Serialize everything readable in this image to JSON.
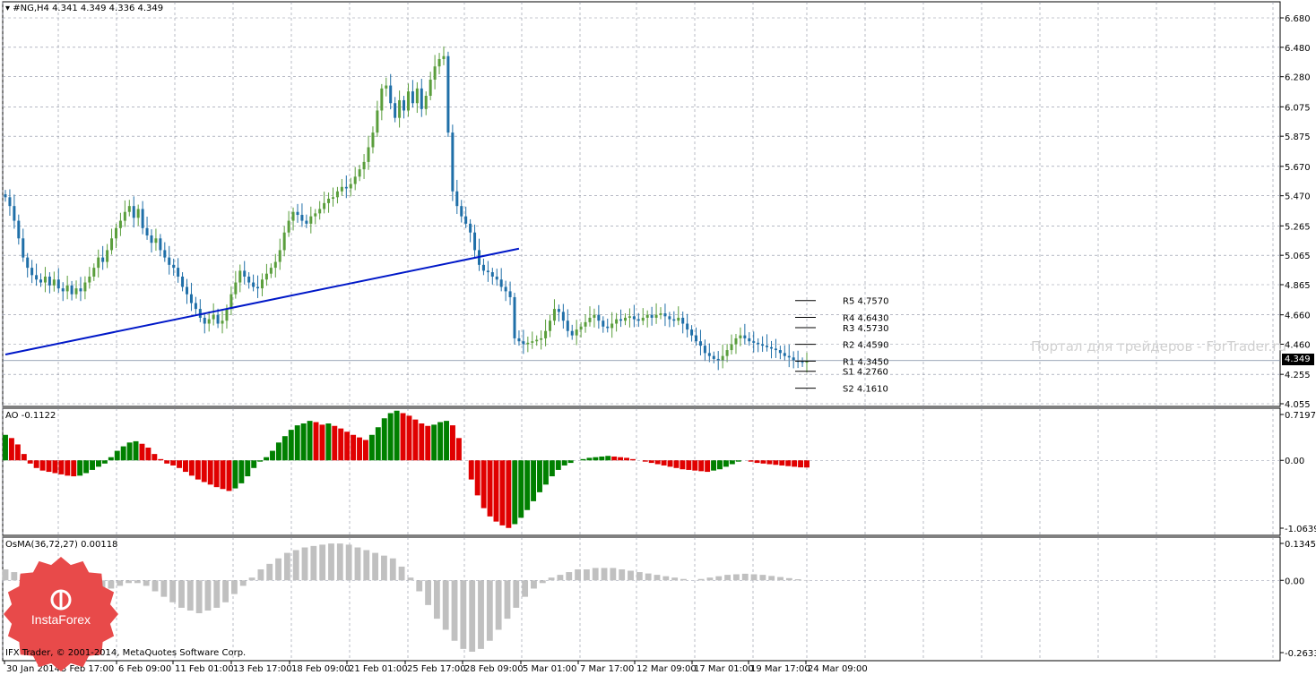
{
  "main_panel": {
    "title": "#NG,H4  4.341 4.349 4.336 4.349",
    "price_axis": [
      "6.680",
      "6.480",
      "6.280",
      "6.075",
      "5.875",
      "5.670",
      "5.470",
      "5.265",
      "5.065",
      "4.865",
      "4.660",
      "4.460",
      "4.255",
      "4.055"
    ],
    "current_price": "4.349",
    "pivots": [
      {
        "label": "R5",
        "value": "4.7570"
      },
      {
        "label": "R4",
        "value": "4.6430"
      },
      {
        "label": "R3",
        "value": "4.5730"
      },
      {
        "label": "R2",
        "value": "4.4590"
      },
      {
        "label": "R1",
        "value": "4.3450"
      },
      {
        "label": "S1",
        "value": "4.2760"
      },
      {
        "label": "S2",
        "value": "4.1610"
      }
    ],
    "watermark": "Портал для трейдеров - ForTrader.ru"
  },
  "ao_panel": {
    "title": "AO -0.1122",
    "axis": [
      "0.7197",
      "0.00",
      "-1.0639"
    ]
  },
  "osma_panel": {
    "title": "OsMA(36,72,27) 0.00118",
    "axis": [
      "0.13452",
      "0.00",
      "-0.2633"
    ]
  },
  "time_axis": [
    "30 Jan 2014",
    "3 Feb 17:00",
    "6 Feb 09:00",
    "11 Feb 01:00",
    "13 Feb 17:00",
    "18 Feb 09:00",
    "21 Feb 01:00",
    "25 Feb 17:00",
    "28 Feb 09:00",
    "5 Mar 01:00",
    "7 Mar 17:00",
    "12 Mar 09:00",
    "17 Mar 01:00",
    "19 Mar 17:00",
    "24 Mar 09:00"
  ],
  "footer": {
    "copyright": "IFX Trader, © 2001-2014, MetaQuotes Software Corp.",
    "logo_text": "InstaForex"
  },
  "colors": {
    "bull_candle": "#5a9e3c",
    "bear_candle": "#1f6fa8",
    "trendline": "#0018c8",
    "ao_up": "#008000",
    "ao_down": "#e00000",
    "osma": "#c0c0c0",
    "grid": "#8a8fa0",
    "logo": "#e84a4a"
  },
  "chart_data": {
    "type": "candlestick",
    "symbol": "#NG",
    "timeframe": "H4",
    "ylim": [
      4.055,
      6.68
    ],
    "close": [
      5.46,
      5.4,
      5.3,
      5.18,
      5.05,
      4.98,
      4.93,
      4.9,
      4.88,
      4.92,
      4.86,
      4.9,
      4.84,
      4.82,
      4.86,
      4.8,
      4.84,
      4.82,
      4.88,
      4.92,
      4.98,
      5.05,
      5.02,
      5.1,
      5.18,
      5.25,
      5.3,
      5.36,
      5.4,
      5.32,
      5.38,
      5.25,
      5.2,
      5.15,
      5.18,
      5.1,
      5.05,
      5.0,
      4.98,
      4.92,
      4.85,
      4.8,
      4.74,
      4.7,
      4.64,
      4.6,
      4.63,
      4.66,
      4.6,
      4.62,
      4.7,
      4.8,
      4.88,
      4.96,
      4.92,
      4.88,
      4.85,
      4.84,
      4.9,
      4.94,
      4.98,
      5.02,
      5.1,
      5.22,
      5.3,
      5.36,
      5.34,
      5.3,
      5.28,
      5.33,
      5.35,
      5.38,
      5.42,
      5.45,
      5.46,
      5.5,
      5.53,
      5.52,
      5.55,
      5.6,
      5.65,
      5.7,
      5.8,
      5.9,
      6.05,
      6.2,
      6.22,
      6.1,
      6.0,
      6.12,
      6.05,
      6.18,
      6.1,
      6.2,
      6.06,
      6.15,
      6.26,
      6.35,
      6.4,
      6.42,
      5.9,
      5.5,
      5.4,
      5.33,
      5.28,
      5.22,
      5.1,
      5.0,
      4.96,
      4.95,
      4.92,
      4.9,
      4.85,
      4.82,
      4.78,
      4.5,
      4.48,
      4.46,
      4.47,
      4.48,
      4.49,
      4.5,
      4.55,
      4.62,
      4.7,
      4.68,
      4.62,
      4.55,
      4.52,
      4.56,
      4.58,
      4.61,
      4.64,
      4.66,
      4.62,
      4.58,
      4.57,
      4.6,
      4.63,
      4.62,
      4.64,
      4.65,
      4.63,
      4.62,
      4.64,
      4.66,
      4.64,
      4.66,
      4.67,
      4.65,
      4.63,
      4.62,
      4.64,
      4.6,
      4.56,
      4.52,
      4.48,
      4.45,
      4.4,
      4.38,
      4.36,
      4.35,
      4.38,
      4.42,
      4.46,
      4.5,
      4.52,
      4.5,
      4.48,
      4.47,
      4.46,
      4.45,
      4.44,
      4.43,
      4.42,
      4.4,
      4.38,
      4.37,
      4.35,
      4.34,
      4.335,
      4.349
    ],
    "trendline": {
      "start": [
        0,
        4.39
      ],
      "end": [
        116,
        5.11
      ]
    },
    "ao_values": [
      0.4,
      0.35,
      0.25,
      0.1,
      -0.05,
      -0.12,
      -0.16,
      -0.18,
      -0.2,
      -0.22,
      -0.24,
      -0.25,
      -0.24,
      -0.2,
      -0.15,
      -0.1,
      -0.05,
      0.05,
      0.15,
      0.22,
      0.28,
      0.3,
      0.26,
      0.2,
      0.1,
      0.02,
      -0.05,
      -0.08,
      -0.12,
      -0.18,
      -0.24,
      -0.3,
      -0.34,
      -0.38,
      -0.42,
      -0.45,
      -0.48,
      -0.44,
      -0.36,
      -0.25,
      -0.12,
      -0.02,
      0.05,
      0.15,
      0.28,
      0.38,
      0.48,
      0.55,
      0.58,
      0.62,
      0.6,
      0.56,
      0.58,
      0.54,
      0.5,
      0.45,
      0.4,
      0.36,
      0.32,
      0.4,
      0.52,
      0.66,
      0.74,
      0.78,
      0.74,
      0.7,
      0.64,
      0.58,
      0.54,
      0.56,
      0.6,
      0.62,
      0.55,
      0.35,
      0.0,
      -0.3,
      -0.55,
      -0.75,
      -0.88,
      -0.96,
      -1.02,
      -1.06,
      -1.0,
      -0.9,
      -0.78,
      -0.64,
      -0.5,
      -0.38,
      -0.25,
      -0.15,
      -0.08,
      -0.04,
      0.0,
      0.02,
      0.04,
      0.05,
      0.06,
      0.07,
      0.06,
      0.05,
      0.04,
      0.02,
      0.0,
      -0.02,
      -0.04,
      -0.06,
      -0.08,
      -0.1,
      -0.12,
      -0.14,
      -0.15,
      -0.16,
      -0.17,
      -0.18,
      -0.16,
      -0.14,
      -0.1,
      -0.06,
      -0.02,
      0.0,
      -0.02,
      -0.04,
      -0.05,
      -0.06,
      -0.07,
      -0.08,
      -0.09,
      -0.1,
      -0.11,
      -0.112
    ],
    "osma_values": [
      0.04,
      0.03,
      0.02,
      0.0,
      -0.02,
      -0.04,
      -0.05,
      -0.06,
      -0.06,
      -0.06,
      -0.05,
      -0.04,
      -0.03,
      -0.02,
      -0.01,
      -0.01,
      -0.02,
      -0.04,
      -0.06,
      -0.08,
      -0.1,
      -0.11,
      -0.12,
      -0.11,
      -0.1,
      -0.08,
      -0.05,
      -0.02,
      0.01,
      0.04,
      0.06,
      0.08,
      0.1,
      0.11,
      0.12,
      0.125,
      0.13,
      0.134,
      0.134,
      0.13,
      0.12,
      0.11,
      0.1,
      0.09,
      0.08,
      0.05,
      0.01,
      -0.04,
      -0.09,
      -0.14,
      -0.18,
      -0.22,
      -0.25,
      -0.26,
      -0.25,
      -0.22,
      -0.18,
      -0.14,
      -0.1,
      -0.06,
      -0.03,
      -0.01,
      0.01,
      0.02,
      0.03,
      0.04,
      0.04,
      0.045,
      0.045,
      0.045,
      0.04,
      0.035,
      0.03,
      0.025,
      0.02,
      0.015,
      0.01,
      0.005,
      0.0,
      0.005,
      0.01,
      0.015,
      0.02,
      0.022,
      0.024,
      0.022,
      0.02,
      0.016,
      0.012,
      0.008,
      0.004,
      0.001
    ]
  }
}
